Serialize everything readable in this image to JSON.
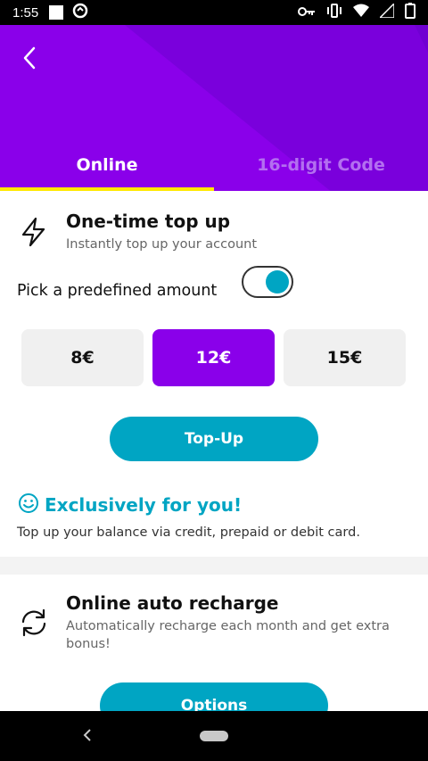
{
  "status_bar": {
    "time": "1:55"
  },
  "header": {
    "tabs": [
      {
        "label": "Online",
        "active": true
      },
      {
        "label": "16-digit Code",
        "active": false
      }
    ]
  },
  "one_time": {
    "title": "One-time top up",
    "subtitle": "Instantly top up your account",
    "icon": "lightning-icon"
  },
  "predefined": {
    "label": "Pick a predefined amount",
    "toggle_on": true
  },
  "amounts": [
    {
      "label": "8€",
      "selected": false
    },
    {
      "label": "12€",
      "selected": true
    },
    {
      "label": "15€",
      "selected": false
    }
  ],
  "topup_button": "Top-Up",
  "exclusive": {
    "title": "Exclusively for you!",
    "description": "Top up your balance via credit, prepaid or debit card.",
    "icon": "smiley-icon"
  },
  "auto_recharge": {
    "title": "Online auto recharge",
    "subtitle": "Automatically recharge each month and get extra bonus!",
    "icon": "refresh-icon"
  },
  "options_button": "Options",
  "colors": {
    "brand_purple": "#8a00ea",
    "accent_teal": "#00a5c3",
    "tab_underline": "#ffe800"
  }
}
